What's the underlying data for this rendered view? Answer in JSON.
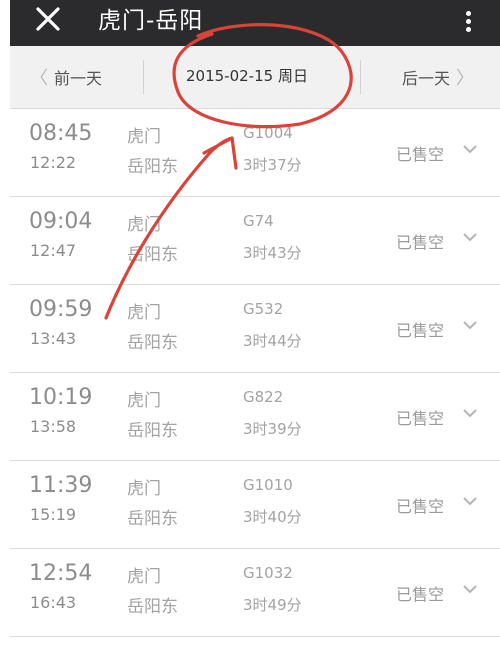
{
  "header": {
    "title": "虎门-岳阳",
    "close_icon": "close-icon",
    "menu_icon": "more-vertical-icon"
  },
  "datebar": {
    "prev_label": "前一天",
    "date": "2015-02-15 周日",
    "next_label": "后一天"
  },
  "colors": {
    "titlebar": "#2b2b2d",
    "annotation": "#d9433a"
  },
  "trains": [
    {
      "depart": "08:45",
      "arrive": "12:22",
      "from": "虎门",
      "to": "岳阳东",
      "number": "G1004",
      "duration": "3时37分",
      "status": "已售空"
    },
    {
      "depart": "09:04",
      "arrive": "12:47",
      "from": "虎门",
      "to": "岳阳东",
      "number": "G74",
      "duration": "3时43分",
      "status": "已售空"
    },
    {
      "depart": "09:59",
      "arrive": "13:43",
      "from": "虎门",
      "to": "岳阳东",
      "number": "G532",
      "duration": "3时44分",
      "status": "已售空"
    },
    {
      "depart": "10:19",
      "arrive": "13:58",
      "from": "虎门",
      "to": "岳阳东",
      "number": "G822",
      "duration": "3时39分",
      "status": "已售空"
    },
    {
      "depart": "11:39",
      "arrive": "15:19",
      "from": "虎门",
      "to": "岳阳东",
      "number": "G1010",
      "duration": "3时40分",
      "status": "已售空"
    },
    {
      "depart": "12:54",
      "arrive": "16:43",
      "from": "虎门",
      "to": "岳阳东",
      "number": "G1032",
      "duration": "3时49分",
      "status": "已售空"
    }
  ]
}
